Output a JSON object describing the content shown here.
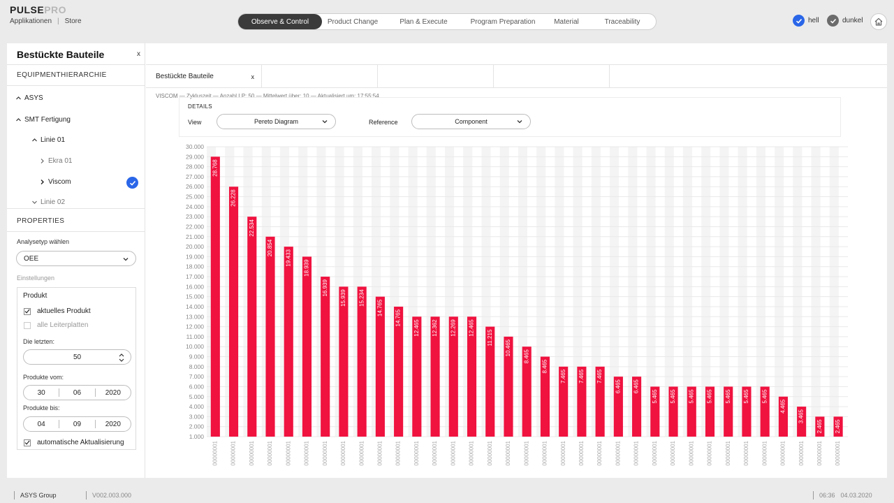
{
  "app": {
    "logo_a": "PULSE",
    "logo_b": "PRO"
  },
  "topnav": {
    "apps": "Applikationen",
    "store": "Store"
  },
  "main_tabs": [
    {
      "label": "Observe & Control",
      "active": true
    },
    {
      "label": "Product Change",
      "active": false
    },
    {
      "label": "Plan & Execute",
      "active": false
    },
    {
      "label": "Program  Preparation",
      "active": false
    },
    {
      "label": "Material",
      "active": false
    },
    {
      "label": "Traceability",
      "active": false
    }
  ],
  "theme": {
    "light": "hell",
    "dark": "dunkel",
    "light_color": "#2a66e8",
    "dark_color": "#6b6b6b"
  },
  "sidebar": {
    "title": "Bestückte Bauteile",
    "close": "x",
    "hierarchy_heading": "EQUIPMENTHIERARCHIE",
    "tree": {
      "asys": "ASYS",
      "smt": "SMT Fertigung",
      "linie1": "Linie 01",
      "ekra": "Ekra 01",
      "viscom": "Viscom",
      "linie2": "Linie 02"
    },
    "properties_heading": "PROPERTIES",
    "analysis_label": "Analysetyp wählen",
    "analysis_value": "OEE",
    "settings_label": "Einstellungen",
    "product_heading": "Produkt",
    "current_product": "aktuelles Produkt",
    "all_boards": "alle Leiterplatten",
    "last_label": "Die letzten:",
    "last_value": "50",
    "from_label": "Produkte vom:",
    "from_date": {
      "d": "30",
      "m": "06",
      "y": "2020"
    },
    "to_label": "Produkte bis:",
    "to_date": {
      "d": "04",
      "m": "09",
      "y": "2020"
    },
    "auto_update": "automatische Aktualisierung"
  },
  "content": {
    "tab_label": "Bestückte Bauteile",
    "tab_close": "x",
    "info": "VISCOM — Zykluszeit — Anzahl LP: 50 — Mittelwert über: 10 — Aktualisiert um: 17:55:54",
    "details_heading": "DETAILS",
    "view_label": "View",
    "view_value": "Pereto Diagram",
    "reference_label": "Reference",
    "reference_value": "Component"
  },
  "chart_data": {
    "type": "bar",
    "bar_color": "#f0123f",
    "ylim": [
      1000,
      30000
    ],
    "yticks": [
      "1.000",
      "2.000",
      "3.000",
      "4.000",
      "5.000",
      "6.000",
      "7.000",
      "8.000",
      "9.000",
      "10.000",
      "11.000",
      "12.000",
      "13.000",
      "14.000",
      "15.000",
      "16.000",
      "17.000",
      "18.000",
      "19.000",
      "20.000",
      "21.000",
      "22.000",
      "23.000",
      "24.000",
      "25.000",
      "26.000",
      "27.000",
      "28.000",
      "29.000",
      "30.000"
    ],
    "values": [
      29000,
      26000,
      23000,
      21000,
      20000,
      19000,
      17000,
      16000,
      16000,
      15000,
      14000,
      13000,
      13000,
      13000,
      13000,
      12000,
      11000,
      10000,
      9000,
      8000,
      8000,
      8000,
      7000,
      7000,
      6000,
      6000,
      6000,
      6000,
      6000,
      6000,
      6000,
      5000,
      4000,
      3000,
      3000
    ],
    "labels": [
      "28.768",
      "26.228",
      "22.534",
      "20.854",
      "19.433",
      "18.939",
      "16.939",
      "15.939",
      "15.234",
      "14.765",
      "14.765",
      "12.465",
      "12.362",
      "12.269",
      "12.465",
      "11.215",
      "10.465",
      "8.465",
      "8.465",
      "7.465",
      "7.465",
      "7.465",
      "6.465",
      "6.465",
      "5.465",
      "5.465",
      "5.465",
      "5.465",
      "5.465",
      "5.465",
      "5.465",
      "4.465",
      "3.465",
      "2.465",
      "2.465"
    ],
    "categories": [
      "00000001",
      "00000001",
      "00000001",
      "00000001",
      "00000001",
      "00000001",
      "00000001",
      "00000001",
      "00000001",
      "00000001",
      "00000001",
      "00000001",
      "00000001",
      "00000001",
      "00000001",
      "00000001",
      "00000001",
      "00000001",
      "00000001",
      "00000001",
      "00000001",
      "00000001",
      "00000001",
      "00000001",
      "00000001",
      "00000001",
      "00000001",
      "00000001",
      "00000001",
      "00000001",
      "00000001",
      "00000001",
      "00000001",
      "00000001",
      "00000001"
    ]
  },
  "footer": {
    "company": "ASYS Group",
    "version": "V002.003.000",
    "time": "06:36",
    "date": "04.03.2020"
  }
}
